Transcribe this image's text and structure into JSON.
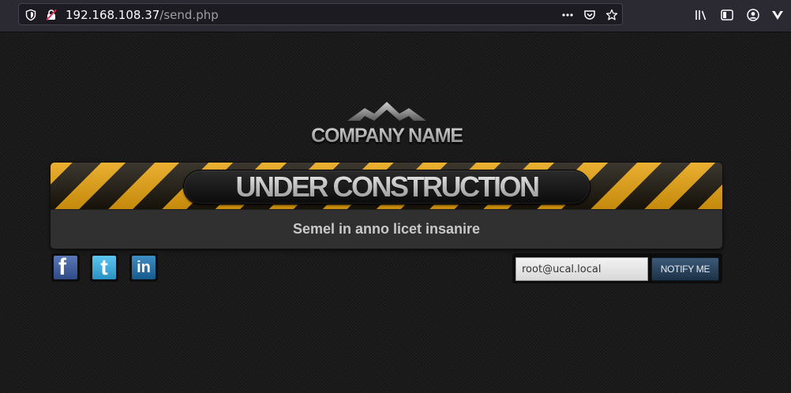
{
  "browser": {
    "url_host": "192.168.108.37",
    "url_path": "/send.php",
    "icons": [
      "shield-icon",
      "insecure-lock-icon",
      "more-dots-icon",
      "pocket-icon",
      "bookmark-star-icon",
      "library-icon",
      "sidebar-icon",
      "account-icon",
      "extension-icon"
    ]
  },
  "page": {
    "company_name": "COMPANY NAME",
    "banner_title": "UNDER CONSTRUCTION",
    "tagline": "Semel in anno licet insanire",
    "social": [
      {
        "name": "facebook",
        "glyph": "f",
        "color": "#3b5998"
      },
      {
        "name": "twitter",
        "glyph": "t",
        "color": "#33aadd"
      },
      {
        "name": "linkedin",
        "glyph": "in",
        "color": "#1d6fa5"
      }
    ],
    "newsletter": {
      "email_value": "root@ucal.local",
      "button_label": "NOTIFY ME"
    },
    "colors": {
      "stripe_yellow": "#e7a20d",
      "background": "#1b1b1b",
      "button_blue": "#2b4763"
    }
  }
}
